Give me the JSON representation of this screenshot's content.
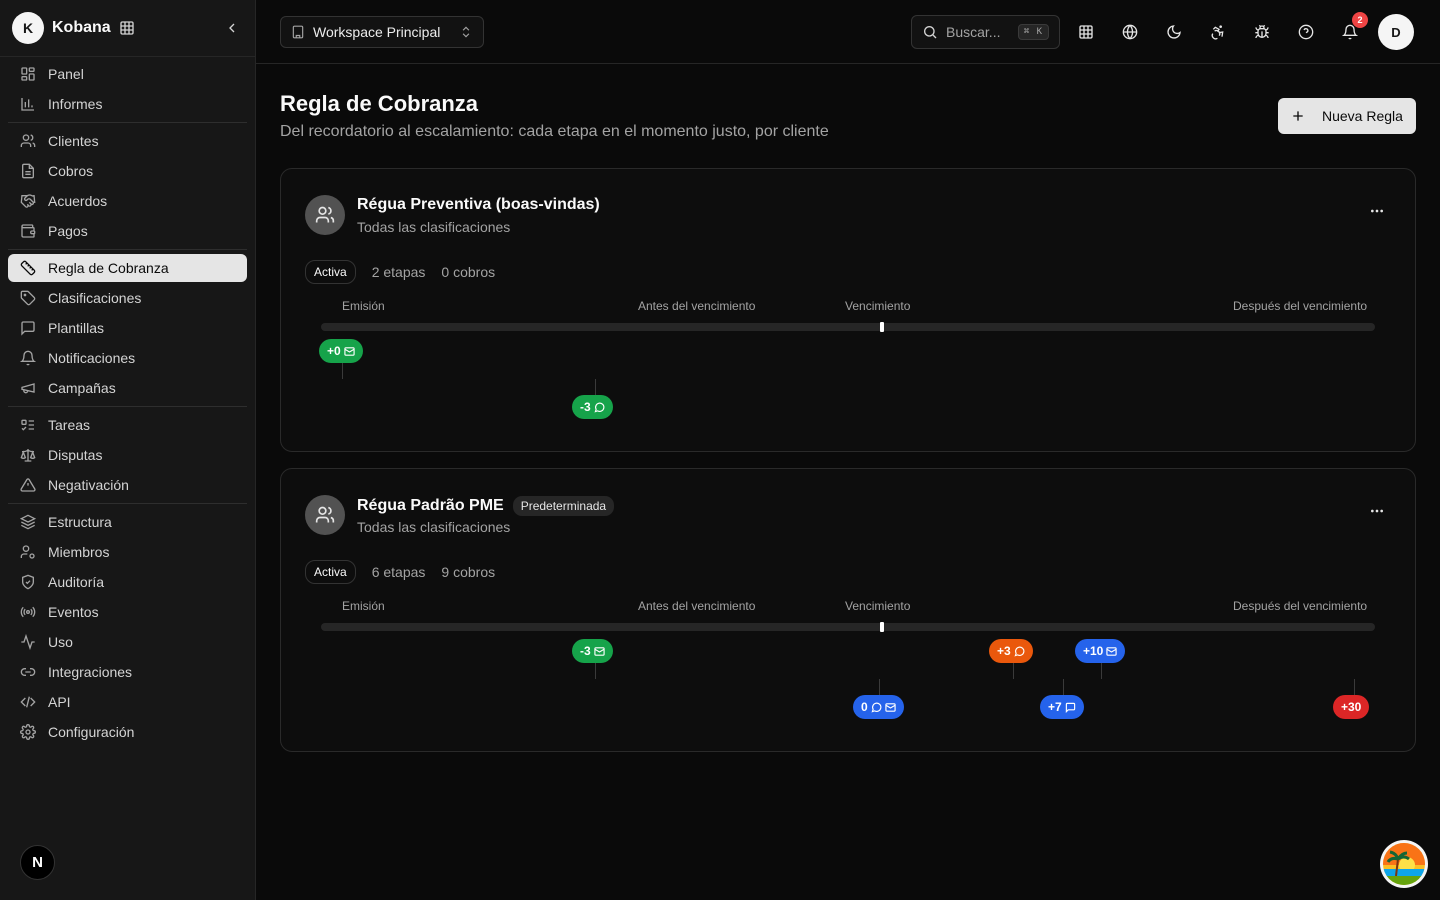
{
  "app": {
    "brand_initial": "K",
    "brand_name": "Kobana"
  },
  "sidebar": {
    "items": [
      {
        "label": "Panel",
        "icon": "dashboard-icon"
      },
      {
        "label": "Informes",
        "icon": "bar-chart-icon"
      },
      {
        "label": "Clientes",
        "icon": "users-icon"
      },
      {
        "label": "Cobros",
        "icon": "receipt-icon"
      },
      {
        "label": "Acuerdos",
        "icon": "handshake-icon"
      },
      {
        "label": "Pagos",
        "icon": "wallet-icon"
      },
      {
        "label": "Regla de Cobranza",
        "icon": "ruler-icon",
        "active": true
      },
      {
        "label": "Clasificaciones",
        "icon": "tag-icon"
      },
      {
        "label": "Plantillas",
        "icon": "message-square-icon"
      },
      {
        "label": "Notificaciones",
        "icon": "bell-icon"
      },
      {
        "label": "Campañas",
        "icon": "megaphone-icon"
      },
      {
        "label": "Tareas",
        "icon": "list-todo-icon"
      },
      {
        "label": "Disputas",
        "icon": "scale-icon"
      },
      {
        "label": "Negativación",
        "icon": "alert-triangle-icon"
      },
      {
        "label": "Estructura",
        "icon": "layers-icon"
      },
      {
        "label": "Miembros",
        "icon": "user-cog-icon"
      },
      {
        "label": "Auditoría",
        "icon": "shield-check-icon"
      },
      {
        "label": "Eventos",
        "icon": "radio-icon"
      },
      {
        "label": "Uso",
        "icon": "activity-icon"
      },
      {
        "label": "Integraciones",
        "icon": "link-icon"
      },
      {
        "label": "API",
        "icon": "code-icon"
      },
      {
        "label": "Configuración",
        "icon": "settings-icon"
      }
    ],
    "footer_badge": "N"
  },
  "header": {
    "workspace": "Workspace Principal",
    "search_placeholder": "Buscar...",
    "search_shortcut": "⌘ K",
    "notification_count": "2",
    "user_initial": "D"
  },
  "page": {
    "title": "Regla de Cobranza",
    "subtitle": "Del recordatorio al escalamiento: cada etapa en el momento justo, por cliente",
    "new_button": "Nueva Regla"
  },
  "timeline_labels": {
    "emission": "Emisión",
    "before_due": "Antes del vencimiento",
    "due": "Vencimiento",
    "after_due": "Después del vencimiento"
  },
  "rules": [
    {
      "name": "Régua Preventiva (boas-vindas)",
      "default_badge": "",
      "scope": "Todas las clasificaciones",
      "status": "Activa",
      "stages": "2 etapas",
      "charges": "0 cobros",
      "steps": [
        {
          "label": "+0",
          "color": "green",
          "icons": [
            "mail-icon"
          ]
        },
        {
          "label": "-3",
          "color": "green",
          "icons": [
            "whatsapp-icon"
          ]
        }
      ]
    },
    {
      "name": "Régua Padrão PME",
      "default_badge": "Predeterminada",
      "scope": "Todas las clasificaciones",
      "status": "Activa",
      "stages": "6 etapas",
      "charges": "9 cobros",
      "steps": [
        {
          "label": "-3",
          "color": "green",
          "icons": [
            "mail-icon"
          ]
        },
        {
          "label": "0",
          "color": "blue",
          "icons": [
            "whatsapp-icon",
            "mail-icon"
          ]
        },
        {
          "label": "+3",
          "color": "orange",
          "icons": [
            "whatsapp-icon"
          ]
        },
        {
          "label": "+7",
          "color": "blue",
          "icons": [
            "sms-icon"
          ]
        },
        {
          "label": "+10",
          "color": "blue",
          "icons": [
            "mail-icon"
          ]
        },
        {
          "label": "+30",
          "color": "red",
          "icons": []
        }
      ]
    }
  ]
}
